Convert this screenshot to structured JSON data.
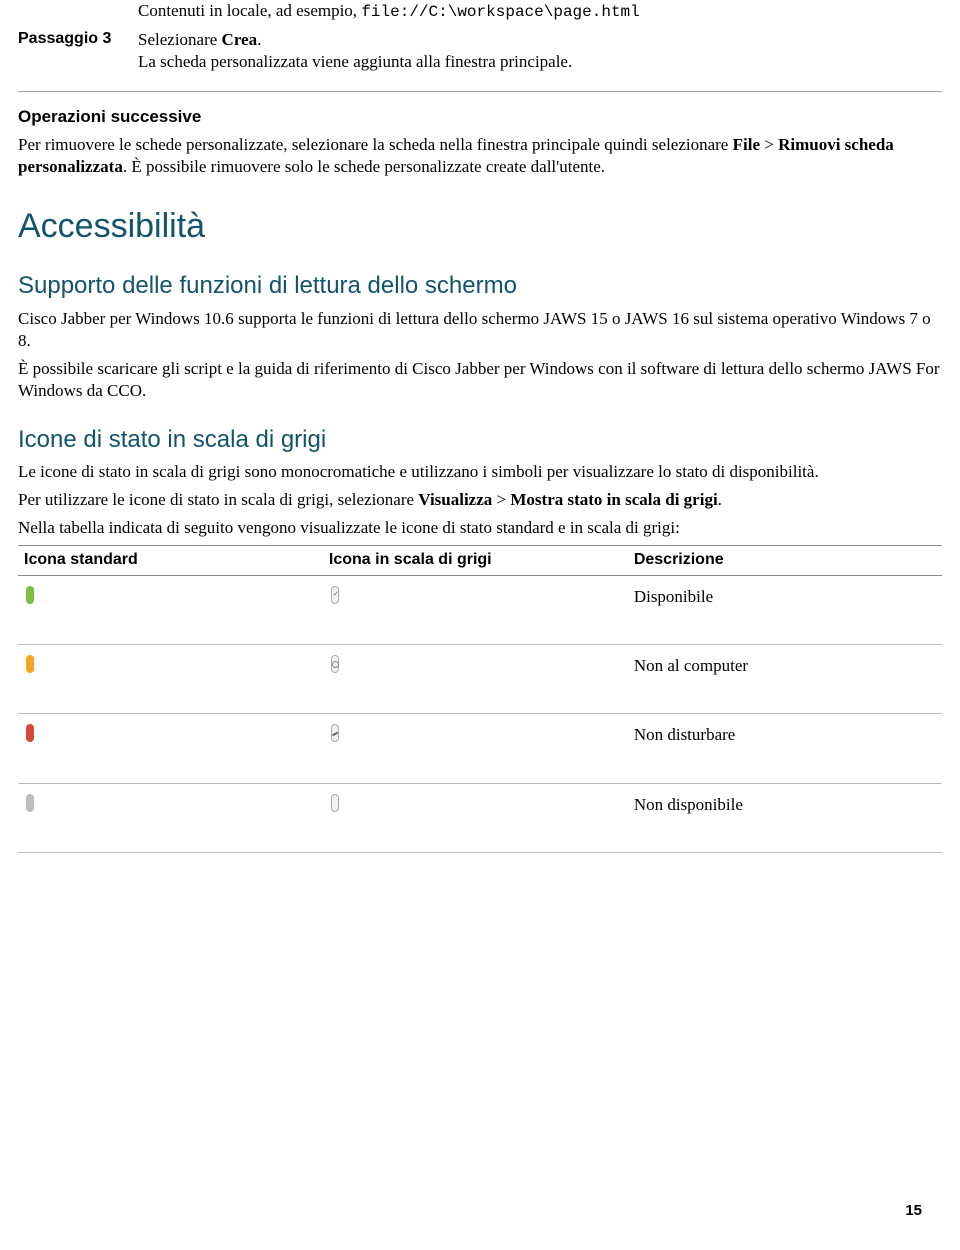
{
  "topline": {
    "prefix": "Contenuti in locale, ad esempio, ",
    "code": "file://C:\\workspace\\page.html"
  },
  "step3": {
    "label": "Passaggio 3",
    "line1_pre": "Selezionare ",
    "line1_bold": "Crea",
    "line1_post": ".",
    "line2": "La scheda personalizzata viene aggiunta alla finestra principale."
  },
  "ops": {
    "heading": "Operazioni successive",
    "p_pre": "Per rimuovere le schede personalizzate, selezionare la scheda nella finestra principale quindi selezionare ",
    "p_bold1": "File",
    "p_mid": " > ",
    "p_bold2": "Rimuovi scheda personalizzata",
    "p_post": ". È possibile rimuovere solo le schede personalizzate create dall'utente."
  },
  "h1_access": "Accessibilità",
  "h2_screen": "Supporto delle funzioni di lettura dello schermo",
  "screen": {
    "p1": "Cisco Jabber per Windows 10.6 supporta le funzioni di lettura dello schermo JAWS 15 o JAWS 16 sul sistema operativo Windows 7 o 8.",
    "p2": "È possibile scaricare gli script e la guida di riferimento di Cisco Jabber per Windows con il software di lettura dello schermo JAWS For Windows da CCO."
  },
  "h2_gray": "Icone di stato in scala di grigi",
  "gray": {
    "p1": "Le icone di stato in scala di grigi sono monocromatiche e utilizzano i simboli per visualizzare lo stato di disponibilità.",
    "p2_pre": "Per utilizzare le icone di stato in scala di grigi, selezionare ",
    "p2_b1": "Visualizza",
    "p2_mid": " > ",
    "p2_b2": "Mostra stato in scala di grigi",
    "p2_post": ".",
    "p3": "Nella tabella indicata di seguito vengono visualizzate le icone di stato standard e in scala di grigi:"
  },
  "table": {
    "h1": "Icona standard",
    "h2": "Icona in scala di grigi",
    "h3": "Descrizione",
    "rows": [
      {
        "std_color": "available",
        "gray_mark": "tick",
        "desc": "Disponibile"
      },
      {
        "std_color": "away",
        "gray_mark": "clock",
        "desc": "Non al computer"
      },
      {
        "std_color": "dnd",
        "gray_mark": "minus",
        "desc": "Non disturbare"
      },
      {
        "std_color": "unavail",
        "gray_mark": "",
        "desc": "Non disponibile"
      }
    ]
  },
  "page_number": "15"
}
